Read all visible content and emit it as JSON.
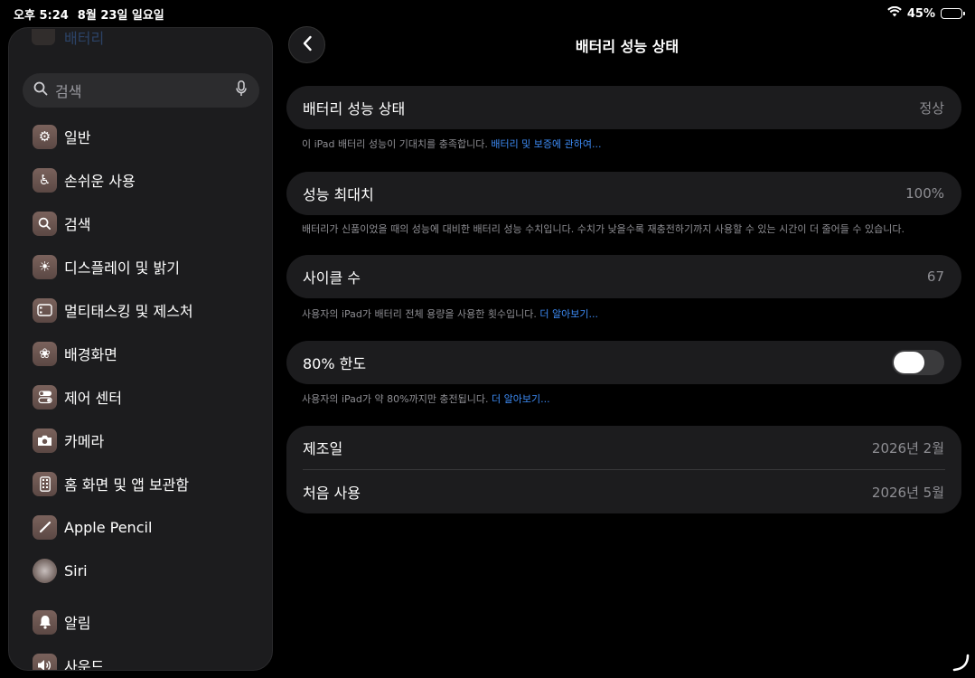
{
  "status": {
    "time": "오후 5:24",
    "date": "8월 23일 일요일",
    "battery_pct": "45%",
    "battery_level": 0.45
  },
  "sidebar": {
    "ghost_item": "배터리",
    "search_placeholder": "검색",
    "items": [
      {
        "label": "일반",
        "icon": "gear-icon"
      },
      {
        "label": "손쉬운 사용",
        "icon": "accessibility-icon"
      },
      {
        "label": "검색",
        "icon": "search-icon"
      },
      {
        "label": "디스플레이 및 밝기",
        "icon": "sun-icon"
      },
      {
        "label": "멀티태스킹 및 제스처",
        "icon": "multitasking-icon"
      },
      {
        "label": "배경화면",
        "icon": "flower-icon"
      },
      {
        "label": "제어 센터",
        "icon": "toggles-icon"
      },
      {
        "label": "카메라",
        "icon": "camera-icon"
      },
      {
        "label": "홈 화면 및 앱 보관함",
        "icon": "home-screen-icon"
      },
      {
        "label": "Apple Pencil",
        "icon": "pencil-icon"
      },
      {
        "label": "Siri",
        "icon": "siri-icon"
      },
      {
        "label": "알림",
        "icon": "bell-icon"
      },
      {
        "label": "사운드",
        "icon": "speaker-icon"
      }
    ]
  },
  "main": {
    "title": "배터리 성능 상태",
    "health": {
      "label": "배터리 성능 상태",
      "value": "정상",
      "footnote": "이 iPad 배터리 성능이 기대치를 충족합니다. ",
      "footnote_link": "배터리 및 보증에 관하여..."
    },
    "max_capacity": {
      "label": "성능 최대치",
      "value": "100%",
      "footnote": "배터리가 신품이었을 때의 성능에 대비한 배터리 성능 수치입니다. 수치가 낮을수록 재충전하기까지 사용할 수 있는 시간이 더 줄어들 수 있습니다."
    },
    "cycle": {
      "label": "사이클 수",
      "value": "67",
      "footnote": "사용자의 iPad가 배터리 전체 용량을 사용한 횟수입니다. ",
      "footnote_link": "더 알아보기..."
    },
    "limit": {
      "label": "80% 한도",
      "enabled": false,
      "footnote": "사용자의 iPad가 약 80%까지만 충전됩니다. ",
      "footnote_link": "더 알아보기..."
    },
    "dates": {
      "manufacture_label": "제조일",
      "manufacture_value": "2026년 2월",
      "first_use_label": "처음 사용",
      "first_use_value": "2026년 5월"
    }
  },
  "colors": {
    "background": "#000000",
    "card": "#1c1c1e",
    "link": "#3d8bf5",
    "secondary_text": "#8e8e93"
  }
}
